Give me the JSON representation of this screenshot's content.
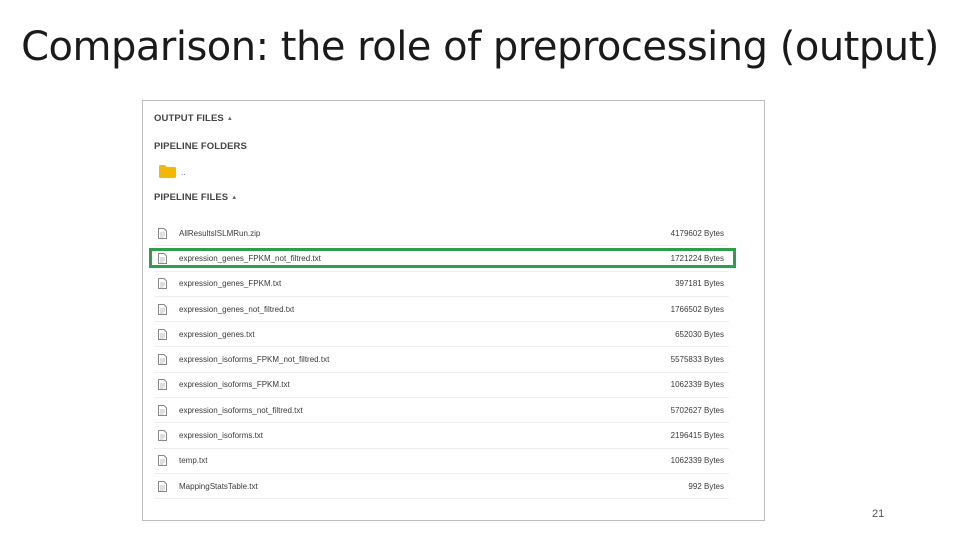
{
  "slide": {
    "title": "Comparison: the role of preprocessing (output)",
    "page_number": "21"
  },
  "colors": {
    "highlight": "#2e9e4a",
    "folder": "#f5b800",
    "panel_border": "#bdbdbd"
  },
  "panel": {
    "output_files_label": "OUTPUT FILES",
    "pipeline_folders_label": "PIPELINE FOLDERS",
    "pipeline_files_label": "PIPELINE FILES",
    "sort_icon": "caret-up-icon",
    "folder": {
      "icon": "folder-icon",
      "label": ".."
    },
    "highlighted_file": "expression_genes_FPKM_not_filtred.txt",
    "files": [
      {
        "name": "AllResultsISLMRun.zip",
        "size": "4179602 Bytes",
        "icon": "file-icon"
      },
      {
        "name": "expression_genes_FPKM_not_filtred.txt",
        "size": "1721224 Bytes",
        "icon": "file-icon"
      },
      {
        "name": "expression_genes_FPKM.txt",
        "size": "397181 Bytes",
        "icon": "file-icon"
      },
      {
        "name": "expression_genes_not_filtred.txt",
        "size": "1766502 Bytes",
        "icon": "file-icon"
      },
      {
        "name": "expression_genes.txt",
        "size": "652030 Bytes",
        "icon": "file-icon"
      },
      {
        "name": "expression_isoforms_FPKM_not_filtred.txt",
        "size": "5575833 Bytes",
        "icon": "file-icon"
      },
      {
        "name": "expression_isoforms_FPKM.txt",
        "size": "1062339 Bytes",
        "icon": "file-icon"
      },
      {
        "name": "expression_isoforms_not_filtred.txt",
        "size": "5702627 Bytes",
        "icon": "file-icon"
      },
      {
        "name": "expression_isoforms.txt",
        "size": "2196415 Bytes",
        "icon": "file-icon"
      },
      {
        "name": "temp.txt",
        "size": "1062339 Bytes",
        "icon": "file-icon"
      },
      {
        "name": "MappingStatsTable.txt",
        "size": "992 Bytes",
        "icon": "file-icon"
      }
    ]
  }
}
